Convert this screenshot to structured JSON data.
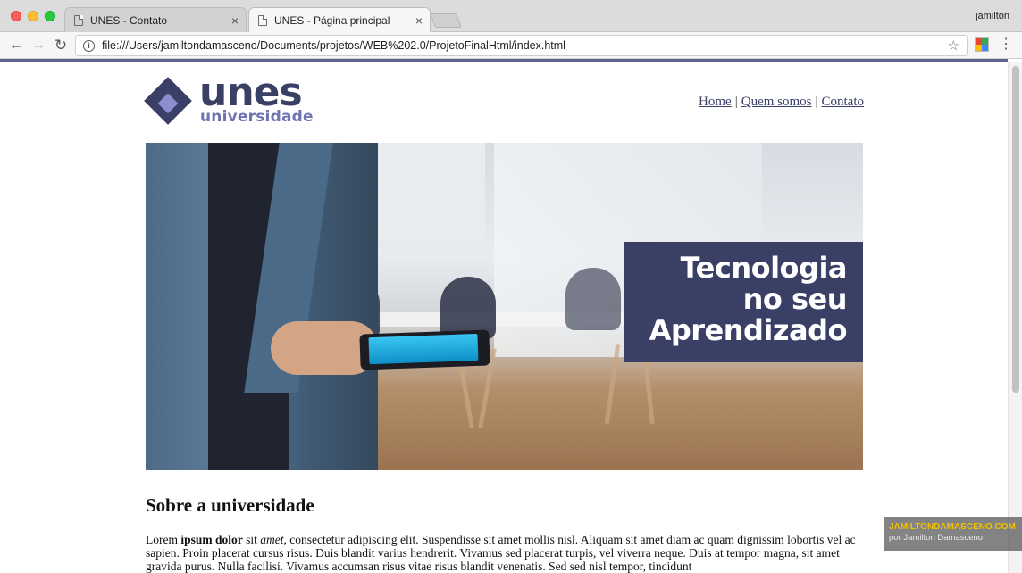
{
  "browser": {
    "tabs": [
      {
        "title": "UNES - Contato",
        "close": "×",
        "active": false
      },
      {
        "title": "UNES - Página principal",
        "close": "×",
        "active": true
      }
    ],
    "profile_name": "jamilton",
    "url": "file:///Users/jamiltondamasceno/Documents/projetos/WEB%202.0/ProjetoFinalHtml/index.html",
    "back_icon": "←",
    "forward_icon": "→",
    "reload_icon": "↻",
    "info_icon": "i",
    "star_icon": "☆",
    "menu_icon": "⋮"
  },
  "site": {
    "logo_word": "unes",
    "logo_sub": "universidade",
    "nav": [
      {
        "label": "Home"
      },
      {
        "label": "Quem somos"
      },
      {
        "label": "Contato"
      }
    ],
    "nav_separator": "|",
    "banner_lines": [
      "Tecnologia",
      "no seu",
      "Aprendizado"
    ],
    "about_title": "Sobre a universidade",
    "about_p1": "Lorem ",
    "about_bold": "ipsum dolor",
    "about_p2": " sit ",
    "about_italic": "amet",
    "about_p3": ", consectetur adipiscing elit. Suspendisse sit amet mollis nisl. Aliquam sit amet diam ac quam dignissim lobortis vel ac sapien. Proin placerat cursus risus. Duis blandit varius hendrerit. Vivamus sed placerat turpis, vel viverra neque. Duis at tempor magna, sit amet gravida purus. Nulla facilisi. Vivamus accumsan risus vitae risus blandit venenatis. Sed sed nisl tempor, tincidunt"
  },
  "watermark": {
    "line1": "JAMILTONDAMASCENO.COM",
    "line2": "por Jamilton Damasceno"
  },
  "colors": {
    "brand_dark": "#3a3f66",
    "brand_light": "#6f73b3",
    "progress": "#5c6390"
  }
}
